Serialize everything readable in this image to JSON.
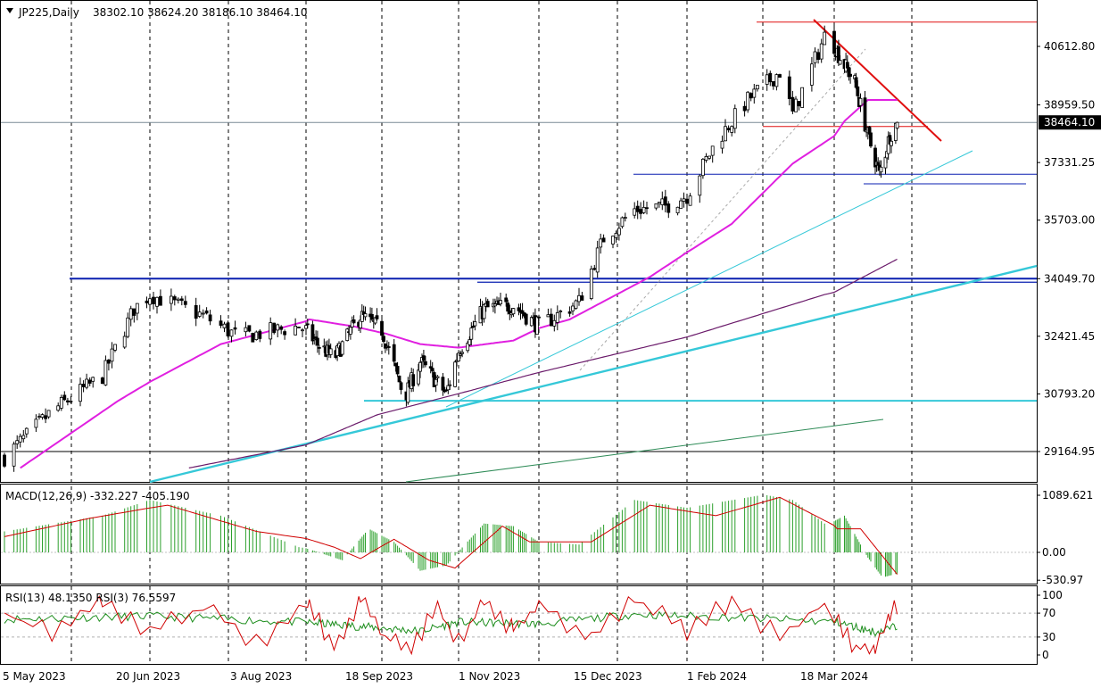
{
  "header": {
    "symbol": "JP225,Daily",
    "ohlc": "38302.10 38624.20 38186.10 38464.10"
  },
  "colors": {
    "candle": "#1a8c1a",
    "ma_fast": "#e020e0",
    "ma_slow": "#6a1a6a",
    "support": "#0a1fb0",
    "trend_cyan": "#35c8d8",
    "resistance": "#e01010",
    "macd_hist": "#2ca02c",
    "macd_signal": "#d00000",
    "rsi_fast": "#d00000",
    "rsi_slow": "#1a8c1a"
  },
  "price_axis": {
    "ticks": [
      "40612.80",
      "38959.50",
      "37331.25",
      "35703.00",
      "34049.70",
      "32421.45",
      "30793.20",
      "29164.95"
    ],
    "current_label": "38464.10"
  },
  "time_axis": {
    "labels": [
      "5 May 2023",
      "20 Jun 2023",
      "3 Aug 2023",
      "18 Sep 2023",
      "1 Nov 2023",
      "15 Dec 2023",
      "1 Feb 2024",
      "18 Mar 2024"
    ]
  },
  "macd_panel": {
    "title": "MACD(12,26,9) -332.227 -405.190",
    "ticks": [
      "1089.621",
      "0.00",
      "-530.97"
    ]
  },
  "rsi_panel": {
    "title": "RSI(13) 48.1350 RSI(3) 76.5597",
    "ticks": [
      "100",
      "70",
      "30",
      "0"
    ]
  },
  "chart_data": {
    "type": "candlestick",
    "title": "JP225,Daily",
    "last_bar": {
      "open": 38302.1,
      "high": 38624.2,
      "low": 38186.1,
      "close": 38464.1
    },
    "x_labels": [
      "5 May 2023",
      "20 Jun 2023",
      "3 Aug 2023",
      "18 Sep 2023",
      "1 Nov 2023",
      "15 Dec 2023",
      "1 Feb 2024",
      "18 Mar 2024"
    ],
    "ylim": [
      28600,
      41500
    ],
    "price_path": [
      {
        "date": "2023-05-05",
        "close": 29000
      },
      {
        "date": "2023-05-20",
        "close": 30300
      },
      {
        "date": "2023-06-05",
        "close": 31300
      },
      {
        "date": "2023-06-15",
        "close": 33200
      },
      {
        "date": "2023-06-20",
        "close": 33600
      },
      {
        "date": "2023-07-05",
        "close": 33000
      },
      {
        "date": "2023-07-15",
        "close": 32400
      },
      {
        "date": "2023-08-01",
        "close": 32700
      },
      {
        "date": "2023-08-10",
        "close": 32200
      },
      {
        "date": "2023-08-20",
        "close": 31800
      },
      {
        "date": "2023-09-05",
        "close": 33000
      },
      {
        "date": "2023-09-18",
        "close": 32600
      },
      {
        "date": "2023-10-01",
        "close": 30700
      },
      {
        "date": "2023-10-10",
        "close": 31700
      },
      {
        "date": "2023-10-25",
        "close": 30800
      },
      {
        "date": "2023-11-01",
        "close": 32000
      },
      {
        "date": "2023-11-15",
        "close": 33200
      },
      {
        "date": "2023-12-01",
        "close": 33300
      },
      {
        "date": "2023-12-15",
        "close": 32700
      },
      {
        "date": "2023-12-28",
        "close": 33400
      },
      {
        "date": "2024-01-05",
        "close": 35200
      },
      {
        "date": "2024-01-15",
        "close": 36000
      },
      {
        "date": "2024-01-25",
        "close": 36100
      },
      {
        "date": "2024-02-01",
        "close": 36400
      },
      {
        "date": "2024-02-10",
        "close": 37900
      },
      {
        "date": "2024-02-20",
        "close": 39100
      },
      {
        "date": "2024-03-01",
        "close": 39900
      },
      {
        "date": "2024-03-05",
        "close": 38700
      },
      {
        "date": "2024-03-15",
        "close": 40900
      },
      {
        "date": "2024-03-22",
        "close": 40300
      },
      {
        "date": "2024-04-01",
        "close": 39600
      },
      {
        "date": "2024-04-10",
        "close": 38100
      },
      {
        "date": "2024-04-18",
        "close": 37000
      },
      {
        "date": "2024-04-25",
        "close": 38100
      },
      {
        "date": "2024-04-30",
        "close": 38464.1
      }
    ],
    "ma_fast_path": [
      {
        "date": "2023-05-10",
        "value": 28700
      },
      {
        "date": "2023-06-10",
        "value": 30600
      },
      {
        "date": "2023-07-10",
        "value": 32200
      },
      {
        "date": "2023-08-05",
        "value": 32900
      },
      {
        "date": "2023-09-01",
        "value": 32700
      },
      {
        "date": "2023-09-20",
        "value": 32500
      },
      {
        "date": "2023-10-10",
        "value": 32200
      },
      {
        "date": "2023-11-01",
        "value": 32100
      },
      {
        "date": "2023-12-01",
        "value": 32300
      },
      {
        "date": "2023-12-25",
        "value": 32900
      },
      {
        "date": "2024-01-20",
        "value": 34100
      },
      {
        "date": "2024-02-15",
        "value": 35600
      },
      {
        "date": "2024-03-05",
        "value": 37300
      },
      {
        "date": "2024-03-25",
        "value": 38500
      },
      {
        "date": "2024-04-10",
        "value": 39100
      },
      {
        "date": "2024-04-30",
        "value": 39100
      }
    ],
    "ma_slow_path": [
      {
        "date": "2023-07-01",
        "value": 28700
      },
      {
        "date": "2023-09-15",
        "value": 30200
      },
      {
        "date": "2023-11-01",
        "value": 30800
      },
      {
        "date": "2023-12-15",
        "value": 31400
      },
      {
        "date": "2024-02-01",
        "value": 32400
      },
      {
        "date": "2024-03-15",
        "value": 33600
      },
      {
        "date": "2024-04-30",
        "value": 34600
      }
    ],
    "macd": {
      "histogram": [
        {
          "date": "2023-05-05",
          "value": 400
        },
        {
          "date": "2023-06-05",
          "value": 700
        },
        {
          "date": "2023-06-20",
          "value": 1000
        },
        {
          "date": "2023-07-10",
          "value": 700
        },
        {
          "date": "2023-08-01",
          "value": 100
        },
        {
          "date": "2023-08-25",
          "value": -150
        },
        {
          "date": "2023-09-10",
          "value": 450
        },
        {
          "date": "2023-09-25",
          "value": 200
        },
        {
          "date": "2023-10-10",
          "value": -350
        },
        {
          "date": "2023-10-25",
          "value": -250
        },
        {
          "date": "2023-11-15",
          "value": 550
        },
        {
          "date": "2023-12-01",
          "value": 500
        },
        {
          "date": "2023-12-15",
          "value": 200
        },
        {
          "date": "2023-12-28",
          "value": 150
        },
        {
          "date": "2024-01-15",
          "value": 1000
        },
        {
          "date": "2024-02-01",
          "value": 850
        },
        {
          "date": "2024-02-25",
          "value": 1100
        },
        {
          "date": "2024-03-05",
          "value": 1000
        },
        {
          "date": "2024-03-15",
          "value": 550
        },
        {
          "date": "2024-03-25",
          "value": 700
        },
        {
          "date": "2024-04-10",
          "value": -100
        },
        {
          "date": "2024-04-20",
          "value": -480
        },
        {
          "date": "2024-04-30",
          "value": -405
        }
      ],
      "signal": [
        {
          "date": "2023-05-05",
          "value": 300
        },
        {
          "date": "2023-06-01",
          "value": 650
        },
        {
          "date": "2023-06-25",
          "value": 900
        },
        {
          "date": "2023-07-20",
          "value": 400
        },
        {
          "date": "2023-08-20",
          "value": 100
        },
        {
          "date": "2023-09-05",
          "value": -120
        },
        {
          "date": "2023-09-25",
          "value": 250
        },
        {
          "date": "2023-10-15",
          "value": -150
        },
        {
          "date": "2023-10-30",
          "value": -300
        },
        {
          "date": "2023-11-25",
          "value": 500
        },
        {
          "date": "2023-12-10",
          "value": 200
        },
        {
          "date": "2024-01-01",
          "value": 200
        },
        {
          "date": "2024-01-20",
          "value": 900
        },
        {
          "date": "2024-02-10",
          "value": 700
        },
        {
          "date": "2024-03-01",
          "value": 1050
        },
        {
          "date": "2024-03-20",
          "value": 450
        },
        {
          "date": "2024-04-05",
          "value": 450
        },
        {
          "date": "2024-04-30",
          "value": -420
        }
      ]
    },
    "rsi": {
      "rsi13": [
        {
          "date": "2023-05-05",
          "value": 60
        },
        {
          "date": "2023-06-20",
          "value": 65
        },
        {
          "date": "2023-08-01",
          "value": 55
        },
        {
          "date": "2023-09-18",
          "value": 45
        },
        {
          "date": "2023-10-10",
          "value": 40
        },
        {
          "date": "2023-11-01",
          "value": 55
        },
        {
          "date": "2023-12-15",
          "value": 52
        },
        {
          "date": "2024-01-15",
          "value": 68
        },
        {
          "date": "2024-02-20",
          "value": 62
        },
        {
          "date": "2024-03-20",
          "value": 55
        },
        {
          "date": "2024-04-15",
          "value": 38
        },
        {
          "date": "2024-04-30",
          "value": 48.135
        }
      ],
      "rsi3_path": [
        {
          "date": "2023-05-05",
          "value": 70
        },
        {
          "date": "2023-05-20",
          "value": 35
        },
        {
          "date": "2023-06-05",
          "value": 85
        },
        {
          "date": "2023-06-20",
          "value": 40
        },
        {
          "date": "2023-07-05",
          "value": 80
        },
        {
          "date": "2023-07-20",
          "value": 20
        },
        {
          "date": "2023-08-05",
          "value": 85
        },
        {
          "date": "2023-08-20",
          "value": 15
        },
        {
          "date": "2023-09-05",
          "value": 90
        },
        {
          "date": "2023-09-20",
          "value": 30
        },
        {
          "date": "2023-10-05",
          "value": 10
        },
        {
          "date": "2023-10-20",
          "value": 80
        },
        {
          "date": "2023-11-01",
          "value": 20
        },
        {
          "date": "2023-11-15",
          "value": 90
        },
        {
          "date": "2023-12-01",
          "value": 40
        },
        {
          "date": "2023-12-15",
          "value": 85
        },
        {
          "date": "2024-01-01",
          "value": 25
        },
        {
          "date": "2024-01-15",
          "value": 95
        },
        {
          "date": "2024-02-01",
          "value": 40
        },
        {
          "date": "2024-02-15",
          "value": 90
        },
        {
          "date": "2024-03-01",
          "value": 30
        },
        {
          "date": "2024-03-15",
          "value": 85
        },
        {
          "date": "2024-03-30",
          "value": 15
        },
        {
          "date": "2024-04-15",
          "value": 10
        },
        {
          "date": "2024-04-25",
          "value": 70
        },
        {
          "date": "2024-04-30",
          "value": 76.5597
        }
      ]
    },
    "levels": [
      {
        "name": "support-34000",
        "value": 34049.7
      },
      {
        "name": "support-33900",
        "value": 33950
      },
      {
        "name": "support-30600",
        "value": 30600
      },
      {
        "name": "support-37000",
        "value": 37000
      },
      {
        "name": "high-41300",
        "value": 41300
      },
      {
        "name": "level-29164",
        "value": 29164.95
      }
    ],
    "grid": true
  }
}
